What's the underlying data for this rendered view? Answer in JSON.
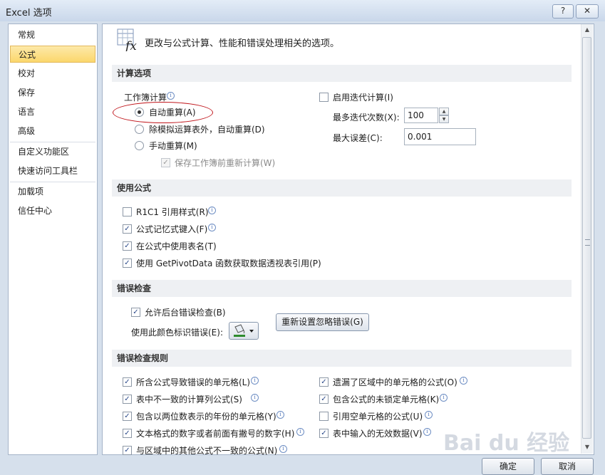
{
  "window": {
    "title": "Excel 选项",
    "help_label": "?",
    "close_label": "✕"
  },
  "nav": {
    "items": [
      "常规",
      "公式",
      "校对",
      "保存",
      "语言",
      "高级",
      "自定义功能区",
      "快速访问工具栏",
      "加载项",
      "信任中心"
    ],
    "selected_index": 1
  },
  "header": {
    "text": "更改与公式计算、性能和错误处理相关的选项。"
  },
  "sections": {
    "calc": "计算选项",
    "formulas": "使用公式",
    "errcheck": "错误检查",
    "errrules": "错误检查规则"
  },
  "calc": {
    "workbook_label": "工作簿计算",
    "auto": "自动重算(A)",
    "auto_except": "除模拟运算表外，自动重算(D)",
    "manual": "手动重算(M)",
    "save_recalc": "保存工作簿前重新计算(W)",
    "iterative": "启用迭代计算(I)",
    "max_iter_label": "最多迭代次数(X):",
    "max_iter_value": "100",
    "max_change_label": "最大误差(C):",
    "max_change_value": "0.001"
  },
  "formulas": {
    "r1c1": "R1C1 引用样式(R)",
    "autocomplete": "公式记忆式键入(F)",
    "table_names": "在公式中使用表名(T)",
    "getpivot": "使用 GetPivotData 函数获取数据透视表引用(P)"
  },
  "errcheck": {
    "background": "允许后台错误检查(B)",
    "color_label": "使用此颜色标识错误(E):",
    "reset_button": "重新设置忽略错误(G)"
  },
  "rules": {
    "r1": "所含公式导致错误的单元格(L)",
    "r2": "表中不一致的计算列公式(S)",
    "r3": "包含以两位数表示的年份的单元格(Y)",
    "r4": "文本格式的数字或者前面有撇号的数字(H)",
    "r5": "与区域中的其他公式不一致的公式(N)",
    "r6": "遗漏了区域中的单元格的公式(O)",
    "r7": "包含公式的未锁定单元格(K)",
    "r8": "引用空单元格的公式(U)",
    "r9": "表中输入的无效数据(V)"
  },
  "footer": {
    "ok": "确定",
    "cancel": "取消"
  },
  "watermark": "Bai du 经验",
  "colors": {
    "nav_selected": "#fbd76c",
    "annotation_oval": "#c0151b",
    "section_bg": "#eef0f3"
  }
}
